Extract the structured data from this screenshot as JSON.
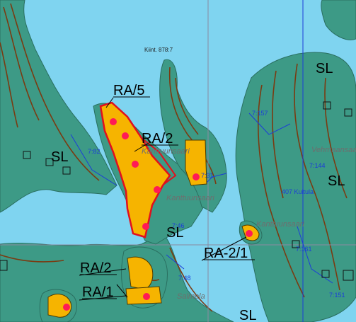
{
  "map": {
    "zones": {
      "ra5": "RA/5",
      "ra2_top": "RA/2",
      "ra2_1": "RA-2/1",
      "ra2_bottom": "RA/2",
      "ra1": "RA/1",
      "sl_left": "SL",
      "sl_mid": "SL",
      "sl_top_right": "SL",
      "sl_right": "SL",
      "sl_bottom": "SL"
    },
    "numbers": {
      "kiint": "Kiint. 878:7",
      "n_782": "7:82",
      "n_731": "7:31",
      "n_746": "7:46",
      "n_7157": "7:157",
      "n_7144": "7:144",
      "n_7151": "7:151",
      "n_7161": "7:161",
      "n_748": "7:48"
    },
    "places": {
      "kanttuu_top": "Kanttuunsaari",
      "kanttuu_mid": "Kanttuunsaari",
      "kanttuu_right": "Kanttuunsaari",
      "kuitula": "407 Kuitula",
      "salmela": "Salmela",
      "vehmaan": "Vehmaansaari"
    },
    "colors": {
      "water": "#7fd4f0",
      "land": "#3d9a86",
      "contour": "#7a3b12",
      "zone_fill": "#f6b400",
      "zone_border": "#e0101e",
      "boundary": "#1c3dd8",
      "grid": "#8a8aa0"
    }
  }
}
